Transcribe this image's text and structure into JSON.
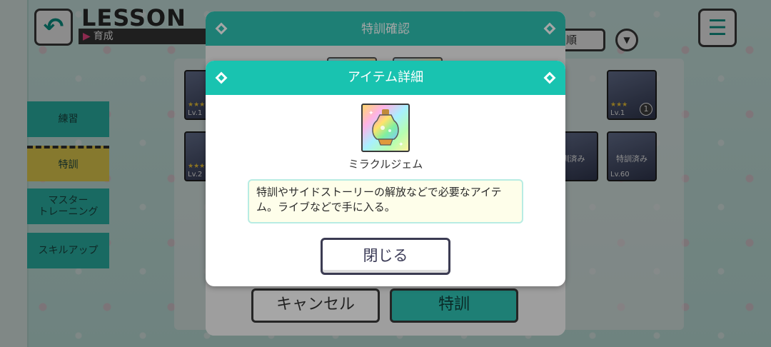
{
  "screen": {
    "title": "LESSON",
    "subtitle": "育成",
    "sort_label": "順"
  },
  "side_menu": [
    {
      "label": "練習"
    },
    {
      "label": "特訓"
    },
    {
      "label": "マスター\nトレーニング"
    },
    {
      "label": "スキルアップ"
    }
  ],
  "cards": [
    {
      "level": "Lv.1",
      "stars": "★★★"
    },
    {
      "level": "Lv.2",
      "stars": "★★★"
    },
    {
      "level": "Lv.1",
      "stars": "★★★",
      "badge": "1"
    },
    {
      "level": "",
      "stars": "",
      "status": "訓済み"
    },
    {
      "level": "Lv.60",
      "stars": "",
      "status": "特訓済み"
    }
  ],
  "confirm_dialog": {
    "title": "特訓確認",
    "cancel_label": "キャンセル",
    "train_label": "特訓"
  },
  "item_dialog": {
    "title": "アイテム詳細",
    "item_name": "ミラクルジェム",
    "item_icon": "rainbow-gem-bottle-icon",
    "description": "特訓やサイドストーリーの解放などで必要なアイテム。ライブなどで手に入る。",
    "close_label": "閉じる"
  },
  "colors": {
    "accent_teal": "#19c3b0",
    "training_yellow": "#f4dc55",
    "desc_bg": "#fefeea"
  }
}
